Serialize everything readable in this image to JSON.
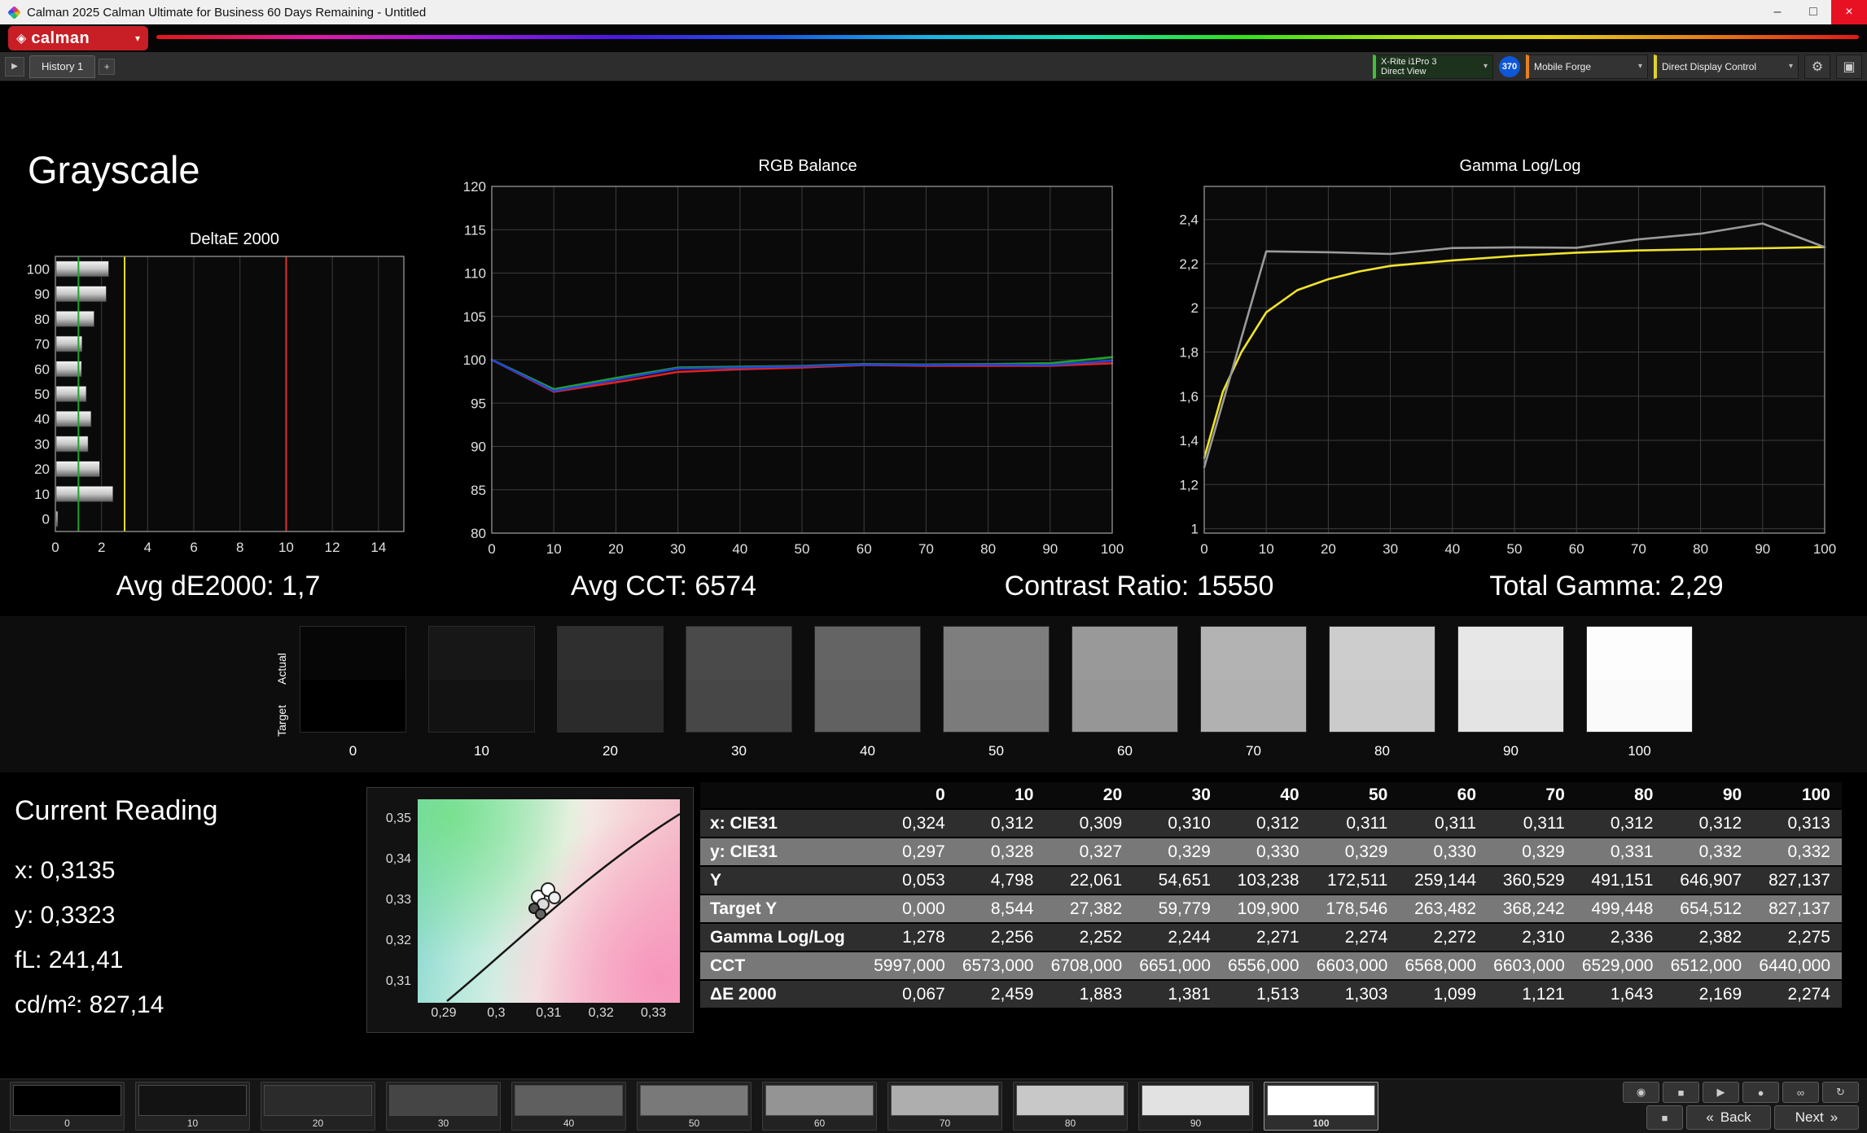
{
  "window": {
    "title": "Calman 2025 Calman Ultimate for Business 60 Days Remaining  - Untitled",
    "logo_text": "calman"
  },
  "icons": {
    "minimize": "–",
    "maximize": "□",
    "close": "×",
    "gear": "⚙",
    "panel": "▣",
    "chevron_down": "▾",
    "expander": "▶",
    "add_tab": "+",
    "logo_gem": "◈",
    "camera": "◉",
    "stop": "■",
    "play": "▶",
    "record": "●",
    "loop": "∞",
    "refresh": "↻",
    "square": "■",
    "back_arrow": "«",
    "next_arrow": "»"
  },
  "toolbar": {
    "history_tab": "History 1",
    "meter_button": {
      "line1": "X-Rite i1Pro 3",
      "line2": "Direct View"
    },
    "badge": "370",
    "source_button": "Mobile Forge",
    "display_control_button": "Direct Display Control"
  },
  "page": {
    "title": "Grayscale"
  },
  "summary": {
    "avg_de": "Avg dE2000: 1,7",
    "avg_cct": "Avg CCT: 6574",
    "contrast_ratio": "Contrast Ratio: 15550",
    "total_gamma": "Total Gamma: 2,29"
  },
  "patch_strip": {
    "actual_label": "Actual",
    "target_label": "Target",
    "levels": [
      {
        "label": "0",
        "actual": "#060606",
        "target": "#000000"
      },
      {
        "label": "10",
        "actual": "#171717",
        "target": "#121212"
      },
      {
        "label": "20",
        "actual": "#2f2f2f",
        "target": "#2b2b2b"
      },
      {
        "label": "30",
        "actual": "#4a4a4a",
        "target": "#474747"
      },
      {
        "label": "40",
        "actual": "#646464",
        "target": "#616161"
      },
      {
        "label": "50",
        "actual": "#7e7e7e",
        "target": "#7b7b7b"
      },
      {
        "label": "60",
        "actual": "#999999",
        "target": "#969696"
      },
      {
        "label": "70",
        "actual": "#b3b3b3",
        "target": "#b1b1b1"
      },
      {
        "label": "80",
        "actual": "#cdcdcd",
        "target": "#cbcbcb"
      },
      {
        "label": "90",
        "actual": "#e7e7e7",
        "target": "#e4e4e4"
      },
      {
        "label": "100",
        "actual": "#fdfdfd",
        "target": "#fafafa"
      }
    ]
  },
  "current_reading": {
    "title": "Current Reading",
    "x": "x: 0,3135",
    "y": "y: 0,3323",
    "fl": "fL: 241,41",
    "cd": "cd/m²: 827,14"
  },
  "cie_plot": {
    "y_ticks": [
      "0,35",
      "0,34",
      "0,33",
      "0,32",
      "0,31"
    ],
    "x_ticks": [
      "0,29",
      "0,3",
      "0,31",
      "0,32",
      "0,33"
    ]
  },
  "table": {
    "columns": [
      "0",
      "10",
      "20",
      "30",
      "40",
      "50",
      "60",
      "70",
      "80",
      "90",
      "100"
    ],
    "rows": [
      {
        "label": "x: CIE31",
        "values": [
          "0,324",
          "0,312",
          "0,309",
          "0,310",
          "0,312",
          "0,311",
          "0,311",
          "0,311",
          "0,312",
          "0,312",
          "0,313"
        ]
      },
      {
        "label": "y: CIE31",
        "values": [
          "0,297",
          "0,328",
          "0,327",
          "0,329",
          "0,330",
          "0,329",
          "0,330",
          "0,329",
          "0,331",
          "0,332",
          "0,332"
        ]
      },
      {
        "label": "Y",
        "values": [
          "0,053",
          "4,798",
          "22,061",
          "54,651",
          "103,238",
          "172,511",
          "259,144",
          "360,529",
          "491,151",
          "646,907",
          "827,137"
        ]
      },
      {
        "label": "Target Y",
        "values": [
          "0,000",
          "8,544",
          "27,382",
          "59,779",
          "109,900",
          "178,546",
          "263,482",
          "368,242",
          "499,448",
          "654,512",
          "827,137"
        ]
      },
      {
        "label": "Gamma Log/Log",
        "values": [
          "1,278",
          "2,256",
          "2,252",
          "2,244",
          "2,271",
          "2,274",
          "2,272",
          "2,310",
          "2,336",
          "2,382",
          "2,275"
        ]
      },
      {
        "label": "CCT",
        "values": [
          "5997,000",
          "6573,000",
          "6708,000",
          "6651,000",
          "6556,000",
          "6603,000",
          "6568,000",
          "6603,000",
          "6529,000",
          "6512,000",
          "6440,000"
        ]
      },
      {
        "label": "ΔE 2000",
        "values": [
          "0,067",
          "2,459",
          "1,883",
          "1,381",
          "1,513",
          "1,303",
          "1,099",
          "1,121",
          "1,643",
          "2,169",
          "2,274"
        ]
      }
    ]
  },
  "chart_data": [
    {
      "type": "bar",
      "title": "DeltaE 2000",
      "orientation": "horizontal",
      "categories": [
        "100",
        "90",
        "80",
        "70",
        "60",
        "50",
        "40",
        "30",
        "20",
        "10",
        "0"
      ],
      "values": [
        2.274,
        2.169,
        1.643,
        1.121,
        1.099,
        1.303,
        1.513,
        1.381,
        1.883,
        2.459,
        0.067
      ],
      "xlabel": "",
      "ylabel": "",
      "xlim": [
        0,
        15.1
      ],
      "xticks": [
        0,
        2,
        4,
        6,
        8,
        10,
        12,
        14
      ],
      "xtick_labels": [
        "0",
        "2",
        "4",
        "6",
        "8",
        "10",
        "12",
        "14"
      ],
      "grid": true,
      "reference_lines": [
        {
          "name": "green-target",
          "value": 1,
          "color": "#1fa32a"
        },
        {
          "name": "yellow-warning",
          "value": 3,
          "color": "#e8e21a"
        },
        {
          "name": "red-limit",
          "value": 10,
          "color": "#e03030"
        }
      ]
    },
    {
      "type": "line",
      "title": "RGB Balance",
      "xlabel": "",
      "ylabel": "",
      "xlim": [
        0,
        100
      ],
      "ylim": [
        80,
        120
      ],
      "xticks": [
        0,
        10,
        20,
        30,
        40,
        50,
        60,
        70,
        80,
        90,
        100
      ],
      "xtick_labels": [
        "0",
        "10",
        "20",
        "30",
        "40",
        "50",
        "60",
        "70",
        "80",
        "90",
        "100"
      ],
      "yticks": [
        120,
        115,
        110,
        105,
        100,
        95,
        90,
        85,
        80
      ],
      "ytick_labels": [
        "120",
        "115",
        "110",
        "105",
        "100",
        "95",
        "90",
        "85",
        "80"
      ],
      "grid": true,
      "x": [
        0,
        10,
        20,
        30,
        40,
        50,
        60,
        70,
        80,
        90,
        100
      ],
      "series": [
        {
          "name": "Red",
          "color": "#e02222",
          "values": [
            100,
            96.3,
            97.4,
            98.6,
            98.9,
            99.1,
            99.4,
            99.3,
            99.3,
            99.3,
            99.6
          ]
        },
        {
          "name": "Green",
          "color": "#1fa32a",
          "values": [
            100,
            96.6,
            97.9,
            99.1,
            99.2,
            99.3,
            99.5,
            99.45,
            99.5,
            99.6,
            100.3
          ]
        },
        {
          "name": "Blue",
          "color": "#2244dd",
          "values": [
            100,
            96.4,
            97.7,
            99.0,
            99.1,
            99.25,
            99.45,
            99.4,
            99.45,
            99.4,
            99.9
          ]
        }
      ]
    },
    {
      "type": "line",
      "title": "Gamma Log/Log",
      "xlabel": "",
      "ylabel": "",
      "xlim": [
        0,
        100
      ],
      "ylim": [
        0.98,
        2.55
      ],
      "xticks": [
        0,
        10,
        20,
        30,
        40,
        50,
        60,
        70,
        80,
        90,
        100
      ],
      "xtick_labels": [
        "0",
        "10",
        "20",
        "30",
        "40",
        "50",
        "60",
        "70",
        "80",
        "90",
        "100"
      ],
      "yticks": [
        2.4,
        2.2,
        2.0,
        1.8,
        1.6,
        1.4,
        1.2,
        1.0
      ],
      "ytick_labels": [
        "2,4",
        "2,2",
        "2",
        "1,8",
        "1,6",
        "1,4",
        "1,2",
        "1"
      ],
      "grid": true,
      "series": [
        {
          "name": "Target gamma",
          "color": "#efe32c",
          "x": [
            0,
            3,
            6,
            10,
            15,
            20,
            25,
            30,
            40,
            50,
            60,
            70,
            80,
            90,
            100
          ],
          "values": [
            1.32,
            1.62,
            1.8,
            1.98,
            2.08,
            2.13,
            2.165,
            2.19,
            2.215,
            2.235,
            2.25,
            2.26,
            2.265,
            2.27,
            2.275
          ]
        },
        {
          "name": "Measured gamma",
          "color": "#9a9a9a",
          "x": [
            0,
            10,
            20,
            30,
            40,
            50,
            60,
            70,
            80,
            90,
            100
          ],
          "values": [
            1.278,
            2.256,
            2.252,
            2.244,
            2.271,
            2.274,
            2.272,
            2.31,
            2.336,
            2.382,
            2.275
          ]
        }
      ]
    }
  ],
  "bottom_bar": {
    "selected": "100",
    "patches": [
      {
        "label": "0",
        "color": "#000000"
      },
      {
        "label": "10",
        "color": "#131313"
      },
      {
        "label": "20",
        "color": "#2b2b2b"
      },
      {
        "label": "30",
        "color": "#454545"
      },
      {
        "label": "40",
        "color": "#5f5f5f"
      },
      {
        "label": "50",
        "color": "#797979"
      },
      {
        "label": "60",
        "color": "#949494"
      },
      {
        "label": "70",
        "color": "#aeaeae"
      },
      {
        "label": "80",
        "color": "#c8c8c8"
      },
      {
        "label": "90",
        "color": "#e2e2e2"
      },
      {
        "label": "100",
        "color": "#ffffff"
      }
    ],
    "back_label": "Back",
    "next_label": "Next"
  }
}
